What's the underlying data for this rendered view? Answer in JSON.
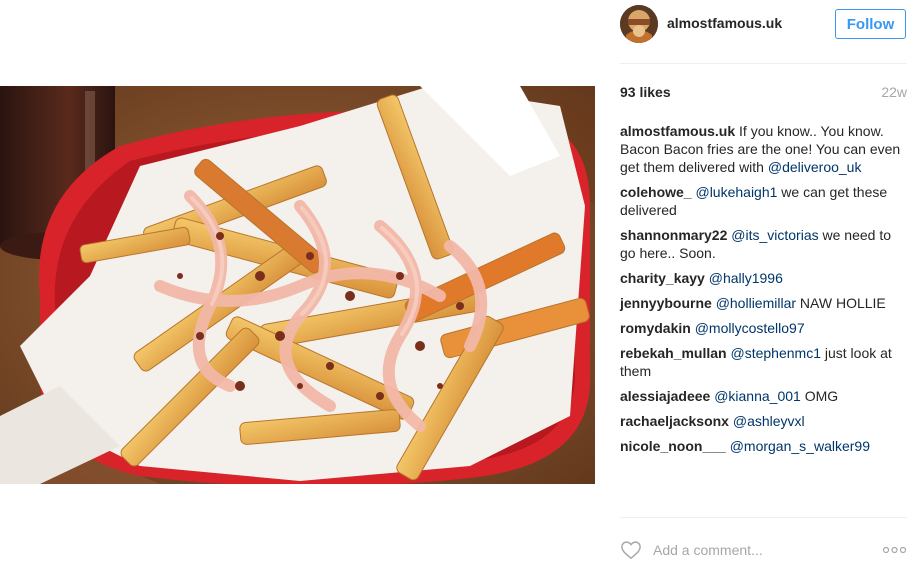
{
  "post": {
    "photo_alt": "Bacon fries in a red basket",
    "author": {
      "username": "almostfamous.uk",
      "avatar_icon": "profile-avatar"
    },
    "follow_label": "Follow",
    "likes": "93 likes",
    "age": "22w",
    "caption": {
      "user": "almostfamous.uk",
      "text": " If you know.. You know. Bacon Bacon fries are the one! You can even get them delivered with ",
      "mention": "@deliveroo_uk"
    },
    "comments": [
      {
        "user": "colehowe_",
        "mention": "@lukehaigh1",
        "text": " we can get these delivered"
      },
      {
        "user": "shannonmary22",
        "mention": "@its_victorias",
        "text": " we need to go here.. Soon."
      },
      {
        "user": "charity_kayy",
        "mention": "@hally1996",
        "text": ""
      },
      {
        "user": "jennyybourne",
        "mention": "@holliemillar",
        "text": " NAW HOLLIE"
      },
      {
        "user": "romydakin",
        "mention": "@mollycostello97",
        "text": ""
      },
      {
        "user": "rebekah_mullan",
        "mention": "@stephenmc1",
        "text": " just look at them"
      },
      {
        "user": "alessiajadeee",
        "mention": "@kianna_001",
        "text": " OMG"
      },
      {
        "user": "rachaeljacksonx",
        "mention": "@ashleyvxl",
        "text": ""
      },
      {
        "user": "nicole_noon___",
        "mention": "@morgan_s_walker99",
        "text": ""
      }
    ],
    "comment_placeholder": "Add a comment...",
    "icons": {
      "like": "heart-outline-icon",
      "more": "more-options-icon"
    },
    "colors": {
      "accent": "#3897f0",
      "mention": "#003569",
      "muted": "#a5a7aa",
      "text": "#262626",
      "divider": "#efefef"
    }
  }
}
